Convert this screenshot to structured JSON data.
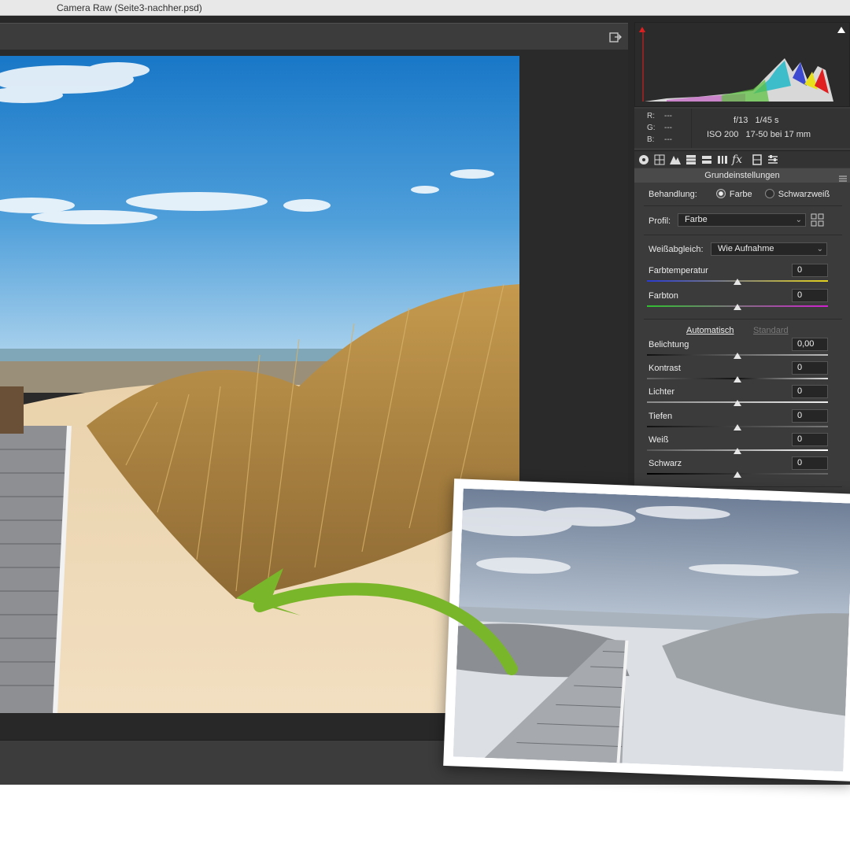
{
  "window": {
    "title": "Camera Raw (Seite3-nachher.psd)"
  },
  "icons": {
    "export": "export-icon",
    "clip_shadow": "shadow-clipping-icon",
    "clip_highlight": "highlight-clipping-icon",
    "panel_menu": "panel-menu-icon"
  },
  "readout": {
    "r_label": "R:",
    "g_label": "G:",
    "b_label": "B:",
    "r": "---",
    "g": "---",
    "b": "---"
  },
  "exif": {
    "aperture": "f/13",
    "shutter": "1/45 s",
    "iso": "ISO 200",
    "lens": "17-50 bei 17 mm"
  },
  "tabs": [
    "basic-icon",
    "tone-curve-icon",
    "detail-icon",
    "hsl-icon",
    "split-toning-icon",
    "lens-corrections-icon",
    "effects-icon",
    "camera-calibration-icon",
    "presets-icon"
  ],
  "panel": {
    "section_title": "Grundeinstellungen",
    "treatment": {
      "label": "Behandlung:",
      "color": "Farbe",
      "bw": "Schwarzweiß",
      "selected": "Farbe"
    },
    "profile": {
      "label": "Profil:",
      "value": "Farbe"
    },
    "white_balance": {
      "label": "Weißabgleich:",
      "value": "Wie Aufnahme"
    },
    "auto_label": "Automatisch",
    "default_label": "Standard",
    "sliders": [
      {
        "label": "Farbtemperatur",
        "value": "0",
        "level": 0.5
      },
      {
        "label": "Farbton",
        "value": "0",
        "level": 0.5
      },
      {
        "label": "Belichtung",
        "value": "0,00",
        "level": 0.5
      },
      {
        "label": "Kontrast",
        "value": "0",
        "level": 0.5
      },
      {
        "label": "Lichter",
        "value": "0",
        "level": 0.5
      },
      {
        "label": "Tiefen",
        "value": "0",
        "level": 0.5
      },
      {
        "label": "Weiß",
        "value": "0",
        "level": 0.5
      },
      {
        "label": "Schwarz",
        "value": "0",
        "level": 0.5
      }
    ]
  },
  "colors": {
    "panel_bg": "#3b3b3b",
    "app_bg": "#282828",
    "arrow": "#79b62a"
  }
}
